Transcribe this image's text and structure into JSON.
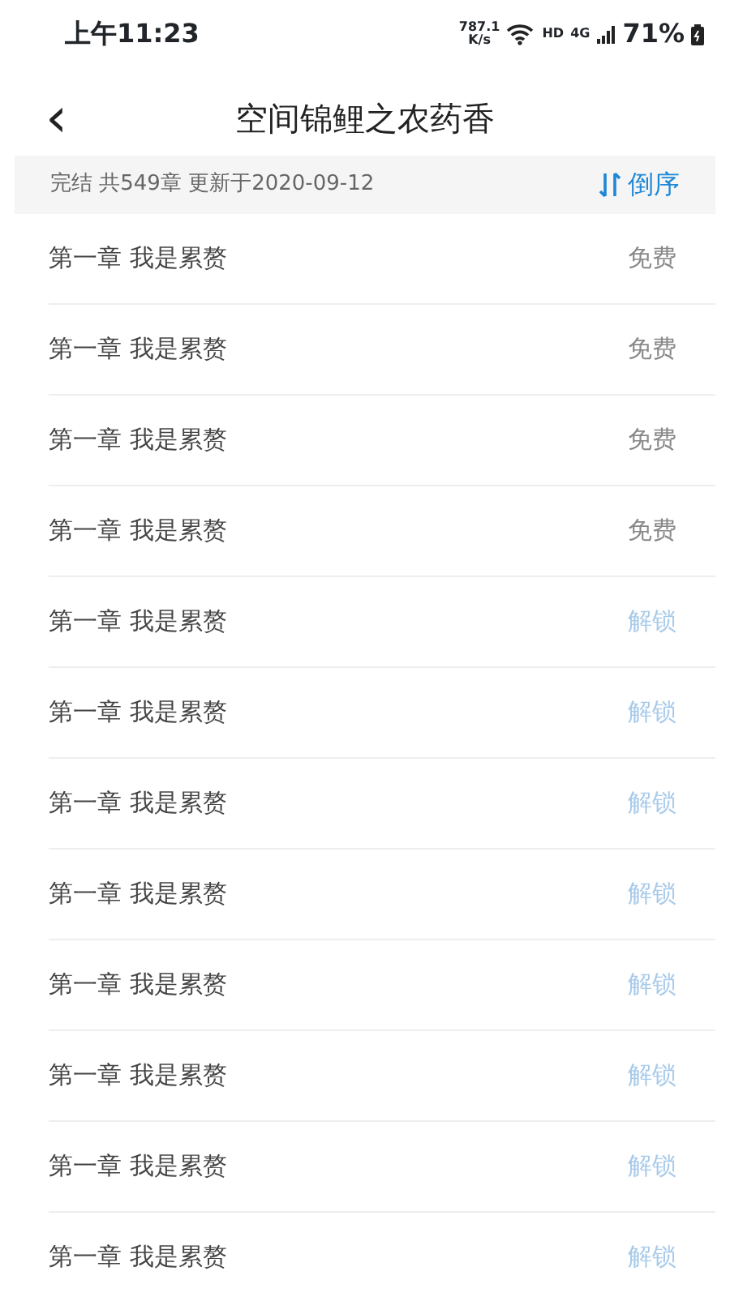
{
  "status_bar": {
    "time": "上午11:23",
    "net_speed": "787.1",
    "net_unit": "K/s",
    "hd": "HD",
    "network": "4G",
    "battery": "71%"
  },
  "header": {
    "back": "‹",
    "title": "空间锦鲤之农药香"
  },
  "info_bar": {
    "summary": "完结 共549章 更新于2020-09-12",
    "sort_label": "倒序"
  },
  "chapters": [
    {
      "title": "第一章 我是累赘",
      "status": "免费",
      "kind": "free"
    },
    {
      "title": "第一章 我是累赘",
      "status": "免费",
      "kind": "free"
    },
    {
      "title": "第一章 我是累赘",
      "status": "免费",
      "kind": "free"
    },
    {
      "title": "第一章 我是累赘",
      "status": "免费",
      "kind": "free"
    },
    {
      "title": "第一章 我是累赘",
      "status": "解锁",
      "kind": "locked"
    },
    {
      "title": "第一章 我是累赘",
      "status": "解锁",
      "kind": "locked"
    },
    {
      "title": "第一章 我是累赘",
      "status": "解锁",
      "kind": "locked"
    },
    {
      "title": "第一章 我是累赘",
      "status": "解锁",
      "kind": "locked"
    },
    {
      "title": "第一章 我是累赘",
      "status": "解锁",
      "kind": "locked"
    },
    {
      "title": "第一章 我是累赘",
      "status": "解锁",
      "kind": "locked"
    },
    {
      "title": "第一章 我是累赘",
      "status": "解锁",
      "kind": "locked"
    },
    {
      "title": "第一章 我是累赘",
      "status": "解锁",
      "kind": "locked"
    }
  ]
}
